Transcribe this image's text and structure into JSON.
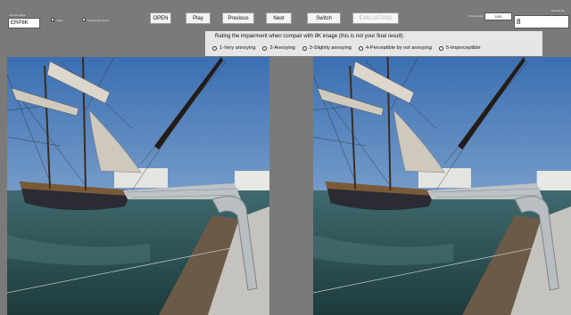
{
  "top_left": {
    "format_label": "Format image",
    "format_value": "ERP8K",
    "checkbox1_label": "Video",
    "checkbox2_label": "Display full screen"
  },
  "buttons": {
    "open": "OPEN",
    "play": "Play",
    "previous": "Previous",
    "next": "Next",
    "switch": "Switch",
    "status": "EVALUATING"
  },
  "top_right": {
    "time_label": "Time display",
    "time_value": "1000",
    "result_label": "Results file",
    "result_value": "8"
  },
  "rating": {
    "question": "Rating the impairment when compair with 8K image (this is not your final result):",
    "options": [
      "1-Very annoying",
      "2-Annoying",
      "3-Slightly annoying",
      "4-Perceptible by not annoying",
      "5-Imperceptible"
    ]
  },
  "images": {
    "left_alt": "Tall ship photo - reference",
    "right_alt": "Tall ship photo - test"
  }
}
